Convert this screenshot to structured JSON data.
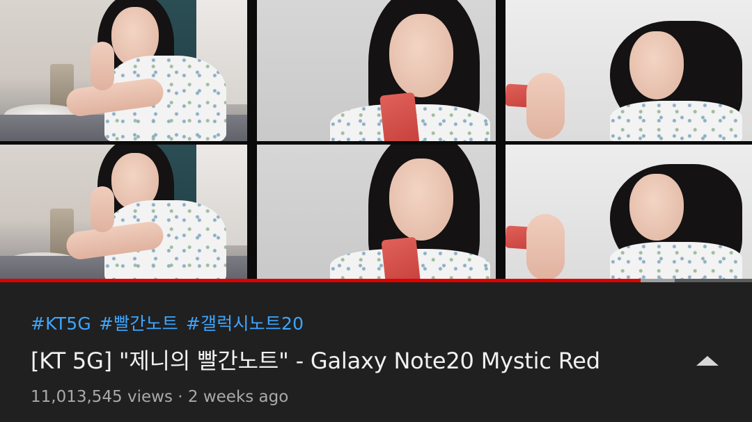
{
  "video": {
    "hashtags": [
      "#KT5G",
      "#빨간노트",
      "#갤럭시노트20"
    ],
    "title": "[KT 5G] \"제니의 빨간노트\" - Galaxy Note20 Mystic Red",
    "views": "11,013,545 views",
    "separator": "·",
    "age": "2 weeks ago"
  },
  "player": {
    "progress_fraction": 0.852,
    "buffered_fraction": 0.897,
    "colors": {
      "played": "#e00000",
      "buffered": "#9f9f9f",
      "track": "#5c5c5c"
    }
  },
  "icons": {
    "expand": "chevron-up-icon"
  },
  "colors": {
    "background": "#202020",
    "hashtag": "#3ea6ff",
    "title": "#f1f1f1",
    "meta": "#aaaaaa"
  }
}
